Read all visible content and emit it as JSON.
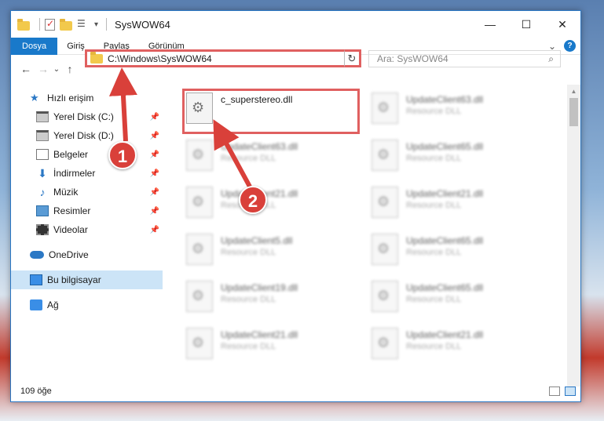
{
  "window": {
    "title": "SysWOW64"
  },
  "titlebar_buttons": {
    "minimize": "—",
    "maximize": "☐",
    "close": "✕"
  },
  "ribbon": {
    "tabs": [
      "Dosya",
      "Giriş",
      "Paylaş",
      "Görünüm"
    ],
    "expand": "⌄",
    "help": "?"
  },
  "nav": {
    "back": "←",
    "forward": "→",
    "recent": "⌄",
    "up": "↑",
    "address": "C:\\Windows\\SysWOW64",
    "refresh": "↻",
    "search_placeholder": "Ara: SysWOW64"
  },
  "sidebar": {
    "quick_access": "Hızlı erişim",
    "items": [
      {
        "label": "Yerel Disk (C:)"
      },
      {
        "label": "Yerel Disk (D:)"
      },
      {
        "label": "Belgeler"
      },
      {
        "label": "İndirmeler"
      },
      {
        "label": "Müzik"
      },
      {
        "label": "Resimler"
      },
      {
        "label": "Videolar"
      }
    ],
    "onedrive": "OneDrive",
    "this_pc": "Bu bilgisayar",
    "network": "Ağ"
  },
  "files": [
    {
      "name": "c_superstereo.dll",
      "desc": ""
    },
    {
      "name": "UpdateClient63.dll",
      "desc": "Resource DLL"
    },
    {
      "name": "UpdateClient63.dll",
      "desc": "Resource DLL"
    },
    {
      "name": "UpdateClient65.dll",
      "desc": "Resource DLL"
    },
    {
      "name": "UpdateClient21.dll",
      "desc": "Resource DLL"
    },
    {
      "name": "UpdateClient21.dll",
      "desc": "Resource DLL"
    },
    {
      "name": "UpdateClient5.dll",
      "desc": "Resource DLL"
    },
    {
      "name": "UpdateClient65.dll",
      "desc": "Resource DLL"
    },
    {
      "name": "UpdateClient19.dll",
      "desc": "Resource DLL"
    },
    {
      "name": "UpdateClient65.dll",
      "desc": "Resource DLL"
    },
    {
      "name": "UpdateClient21.dll",
      "desc": "Resource DLL"
    },
    {
      "name": "UpdateClient21.dll",
      "desc": "Resource DLL"
    }
  ],
  "status": {
    "count": "109 öğe"
  },
  "callouts": [
    "1",
    "2"
  ],
  "colors": {
    "accent": "#1979ca",
    "highlight": "#e06060",
    "callout": "#d9403a"
  }
}
